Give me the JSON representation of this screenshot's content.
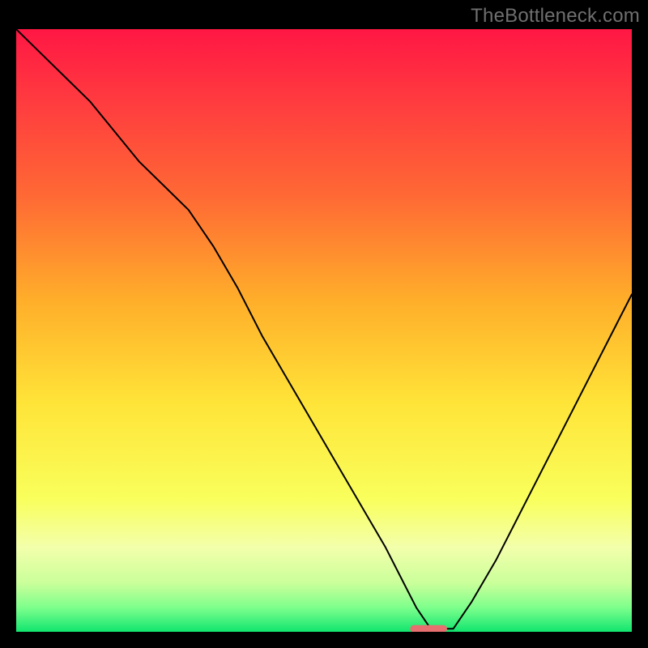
{
  "watermark": {
    "text": "TheBottleneck.com"
  },
  "chart_data": {
    "type": "line",
    "title": "",
    "xlabel": "",
    "ylabel": "",
    "xlim": [
      0,
      100
    ],
    "ylim": [
      0,
      100
    ],
    "grid": false,
    "legend": false,
    "annotations": [],
    "background": {
      "type": "vertical-gradient",
      "stops": [
        {
          "pos": 0.0,
          "color": "#ff1744"
        },
        {
          "pos": 0.12,
          "color": "#ff3b3f"
        },
        {
          "pos": 0.28,
          "color": "#ff6a34"
        },
        {
          "pos": 0.45,
          "color": "#ffae2a"
        },
        {
          "pos": 0.62,
          "color": "#ffe438"
        },
        {
          "pos": 0.78,
          "color": "#f9ff5c"
        },
        {
          "pos": 0.86,
          "color": "#f3ffab"
        },
        {
          "pos": 0.92,
          "color": "#c9ff9a"
        },
        {
          "pos": 0.96,
          "color": "#7dff8c"
        },
        {
          "pos": 1.0,
          "color": "#11e56f"
        }
      ]
    },
    "marker": {
      "shape": "rounded-bar",
      "x_center": 67,
      "y": 0.5,
      "width": 6,
      "height": 1.2,
      "color": "#e76f6f"
    },
    "series": [
      {
        "name": "bottleneck-curve",
        "color": "#000000",
        "stroke_width": 2,
        "x": [
          0,
          4,
          8,
          12,
          16,
          20,
          24,
          28,
          32,
          36,
          40,
          44,
          48,
          52,
          56,
          60,
          63,
          65,
          67,
          69,
          71,
          74,
          78,
          82,
          86,
          90,
          94,
          98,
          100
        ],
        "y": [
          100,
          96,
          92,
          88,
          83,
          78,
          74,
          70,
          64,
          57,
          49,
          42,
          35,
          28,
          21,
          14,
          8,
          4,
          1,
          0.5,
          0.5,
          5,
          12,
          20,
          28,
          36,
          44,
          52,
          56
        ]
      }
    ]
  }
}
